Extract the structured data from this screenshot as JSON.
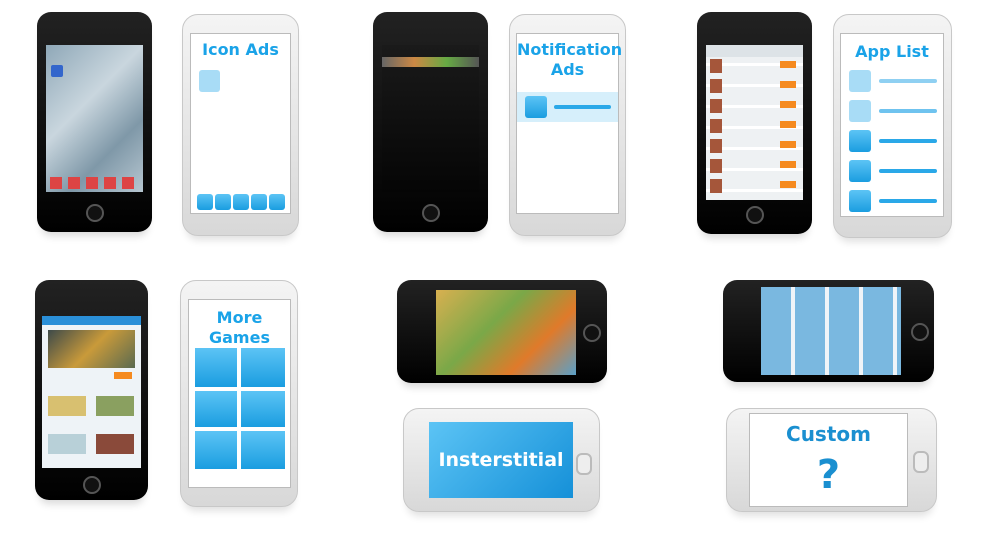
{
  "formats": [
    {
      "id": "icon-ads",
      "title": "Icon Ads"
    },
    {
      "id": "notification-ads",
      "title_line1": "Notification",
      "title_line2": "Ads"
    },
    {
      "id": "app-list",
      "title": "App List"
    },
    {
      "id": "more-games",
      "title": "More Games"
    },
    {
      "id": "interstitial",
      "title": "Insterstitial"
    },
    {
      "id": "custom",
      "title": "Custom",
      "symbol": "?"
    }
  ],
  "colors": {
    "accent": "#1aa3e8",
    "phone_black": "#000000",
    "phone_white": "#e6e6e6",
    "cta_orange": "#f58a1f"
  }
}
